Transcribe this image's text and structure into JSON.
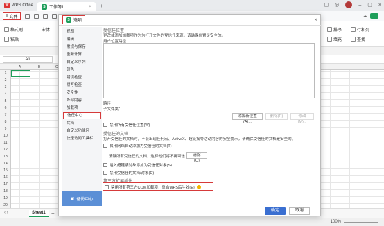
{
  "titlebar": {
    "app_name": "WPS Office",
    "doc_tab": "工作簿1",
    "new_tab": "+"
  },
  "menu": {
    "file_label": "文件"
  },
  "ribbon": {
    "format_painter": "格式刷",
    "paste": "粘贴",
    "font": "宋体",
    "sort": "排序",
    "row_col": "行和列",
    "fill": "填充",
    "find": "查找"
  },
  "formula_bar": {
    "name_box": "A1"
  },
  "columns": [
    "A",
    "B",
    "C"
  ],
  "rows": [
    "1",
    "2",
    "3",
    "4",
    "5",
    "6",
    "7",
    "8",
    "9",
    "10",
    "11",
    "12",
    "13",
    "14",
    "15",
    "16",
    "17",
    "18",
    "19",
    "20"
  ],
  "sheet_tab": "Sheet1",
  "status": {
    "zoom": "100%"
  },
  "dialog": {
    "title": "选项",
    "close": "×",
    "sidebar": [
      "视图",
      "编辑",
      "常规与保存",
      "重新计算",
      "自定义序列",
      "颜色",
      "错误检查",
      "拼写检查",
      "安全性",
      "外部内容",
      "加载项",
      "信任中心",
      "文档",
      "自定义功能区",
      "快速访问工具栏"
    ],
    "backup": "备份中心",
    "trusted_locations": {
      "title": "受信任位置",
      "desc": "更改或添加加载项作为为打开文件的受信任来源，请确保位置是安全的。",
      "user_path": "用户位置路径：",
      "path_label": "路径：",
      "subfolder_label": "子文件夹：",
      "add_btn": "添加新位置(A)...",
      "delete_btn": "删除(R)",
      "modify_btn": "修改(M)...",
      "disable_all": "禁用所有受信任位置(W)"
    },
    "trusted_docs": {
      "title": "受信任的文档",
      "desc": "打开受信任的文档时，不会出现任何宏、ActiveX、超链接等活动内容的安全提示，请确保受信任的文档是安全的。",
      "cb_network": "启用网络自动添加为受信任的文档(T)",
      "clear_text": "清除所有受信任的文档，这样他们将不再可信",
      "clear_btn": "清除(C)",
      "cb_insert_pic": "插入超链接对象添加为受信任对象(S)",
      "cb_disable": "禁用受信任的文档/对象(D)"
    },
    "third_party": {
      "title": "第三方扩展插件",
      "cb_disable_com": "禁用所有第三方COM加载项，重启WPS后生效(E)"
    },
    "ok": "确定",
    "cancel": "取消"
  }
}
